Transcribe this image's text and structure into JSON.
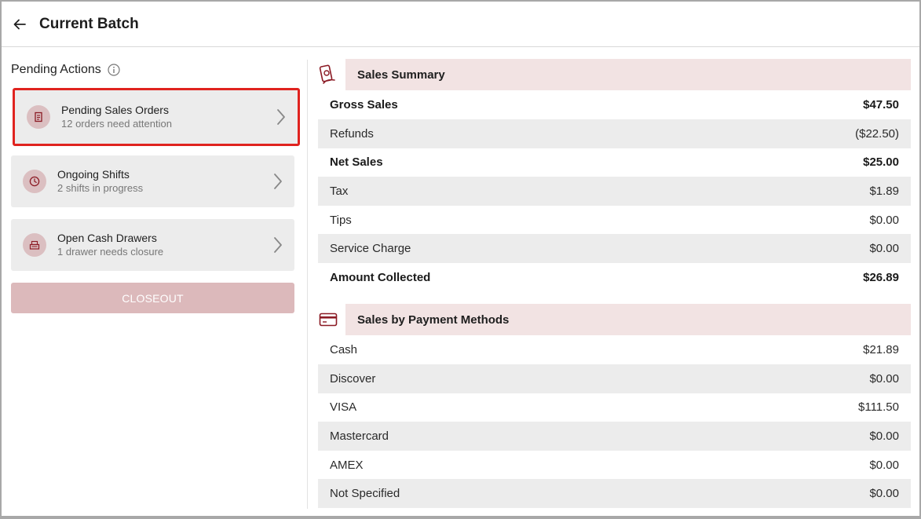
{
  "header": {
    "title": "Current Batch",
    "back_icon": "arrow-left-icon"
  },
  "pending": {
    "heading": "Pending Actions",
    "info_icon": "info-icon",
    "cards": [
      {
        "title": "Pending Sales Orders",
        "subtitle": "12 orders need attention",
        "icon": "receipt-icon",
        "highlighted": true
      },
      {
        "title": "Ongoing Shifts",
        "subtitle": "2 shifts in progress",
        "icon": "clock-icon",
        "highlighted": false
      },
      {
        "title": "Open Cash Drawers",
        "subtitle": "1 drawer needs closure",
        "icon": "cash-register-icon",
        "highlighted": false
      }
    ],
    "closeout_label": "CLOSEOUT"
  },
  "sales_summary": {
    "title": "Sales Summary",
    "icon": "money-hand-icon",
    "rows": [
      {
        "label": "Gross Sales",
        "value": "$47.50",
        "bold": true
      },
      {
        "label": "Refunds",
        "value": "($22.50)",
        "bold": false
      },
      {
        "label": "Net Sales",
        "value": "$25.00",
        "bold": true
      },
      {
        "label": "Tax",
        "value": "$1.89",
        "bold": false
      },
      {
        "label": "Tips",
        "value": "$0.00",
        "bold": false
      },
      {
        "label": "Service Charge",
        "value": "$0.00",
        "bold": false
      },
      {
        "label": "Amount Collected",
        "value": "$26.89",
        "bold": true
      }
    ]
  },
  "payment_methods": {
    "title": "Sales by Payment Methods",
    "icon": "credit-card-icon",
    "rows": [
      {
        "label": "Cash",
        "value": "$21.89"
      },
      {
        "label": "Discover",
        "value": "$0.00"
      },
      {
        "label": "VISA",
        "value": "$111.50"
      },
      {
        "label": "Mastercard",
        "value": "$0.00"
      },
      {
        "label": "AMEX",
        "value": "$0.00"
      },
      {
        "label": "Not Specified",
        "value": "$0.00"
      }
    ]
  },
  "colors": {
    "accent": "#8b1a24",
    "highlight_border": "#e0231f",
    "section_bg": "#f2e3e3",
    "button_bg": "#dcb9bb"
  }
}
